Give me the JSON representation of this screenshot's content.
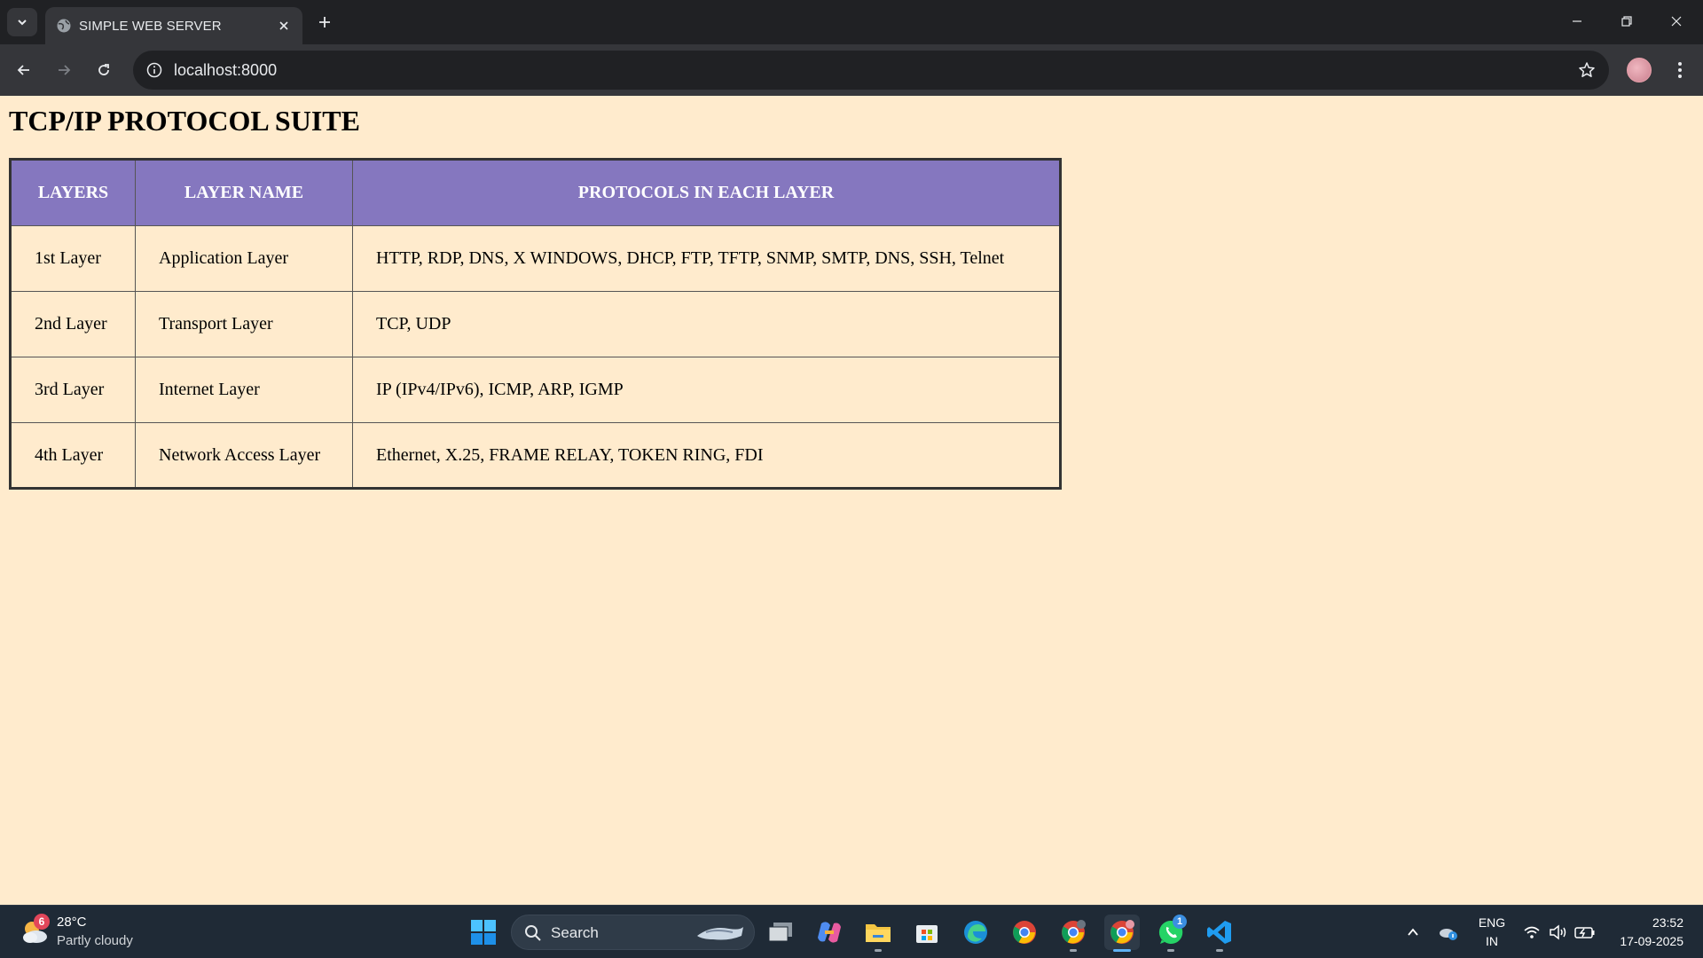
{
  "browser": {
    "tab_title": "SIMPLE WEB SERVER",
    "url": "localhost:8000"
  },
  "page": {
    "title": "TCP/IP PROTOCOL SUITE",
    "table": {
      "headers": [
        "LAYERS",
        "LAYER NAME",
        "PROTOCOLS IN EACH LAYER"
      ],
      "rows": [
        [
          "1st Layer",
          "Application Layer",
          "HTTP, RDP, DNS, X WINDOWS, DHCP, FTP, TFTP, SNMP, SMTP, DNS, SSH, Telnet"
        ],
        [
          "2nd Layer",
          "Transport Layer",
          "TCP, UDP"
        ],
        [
          "3rd Layer",
          "Internet Layer",
          "IP (IPv4/IPv6), ICMP, ARP, IGMP"
        ],
        [
          "4th Layer",
          "Network Access Layer",
          "Ethernet, X.25, FRAME RELAY, TOKEN RING, FDI"
        ]
      ]
    },
    "colors": {
      "background": "#ffebcd",
      "header_bg": "#8577bf",
      "header_text": "#ffffff"
    }
  },
  "taskbar": {
    "weather_temp": "28°C",
    "weather_desc": "Partly cloudy",
    "weather_badge": "6",
    "search_label": "Search",
    "whatsapp_badge": "1",
    "lang_line1": "ENG",
    "lang_line2": "IN",
    "time": "23:52",
    "date": "17-09-2025",
    "apps": [
      "windows-start",
      "task-view",
      "copilot",
      "file-explorer",
      "microsoft-store",
      "edge",
      "chrome",
      "chrome-profile-2",
      "chrome-profile-active",
      "whatsapp",
      "vscode"
    ]
  }
}
